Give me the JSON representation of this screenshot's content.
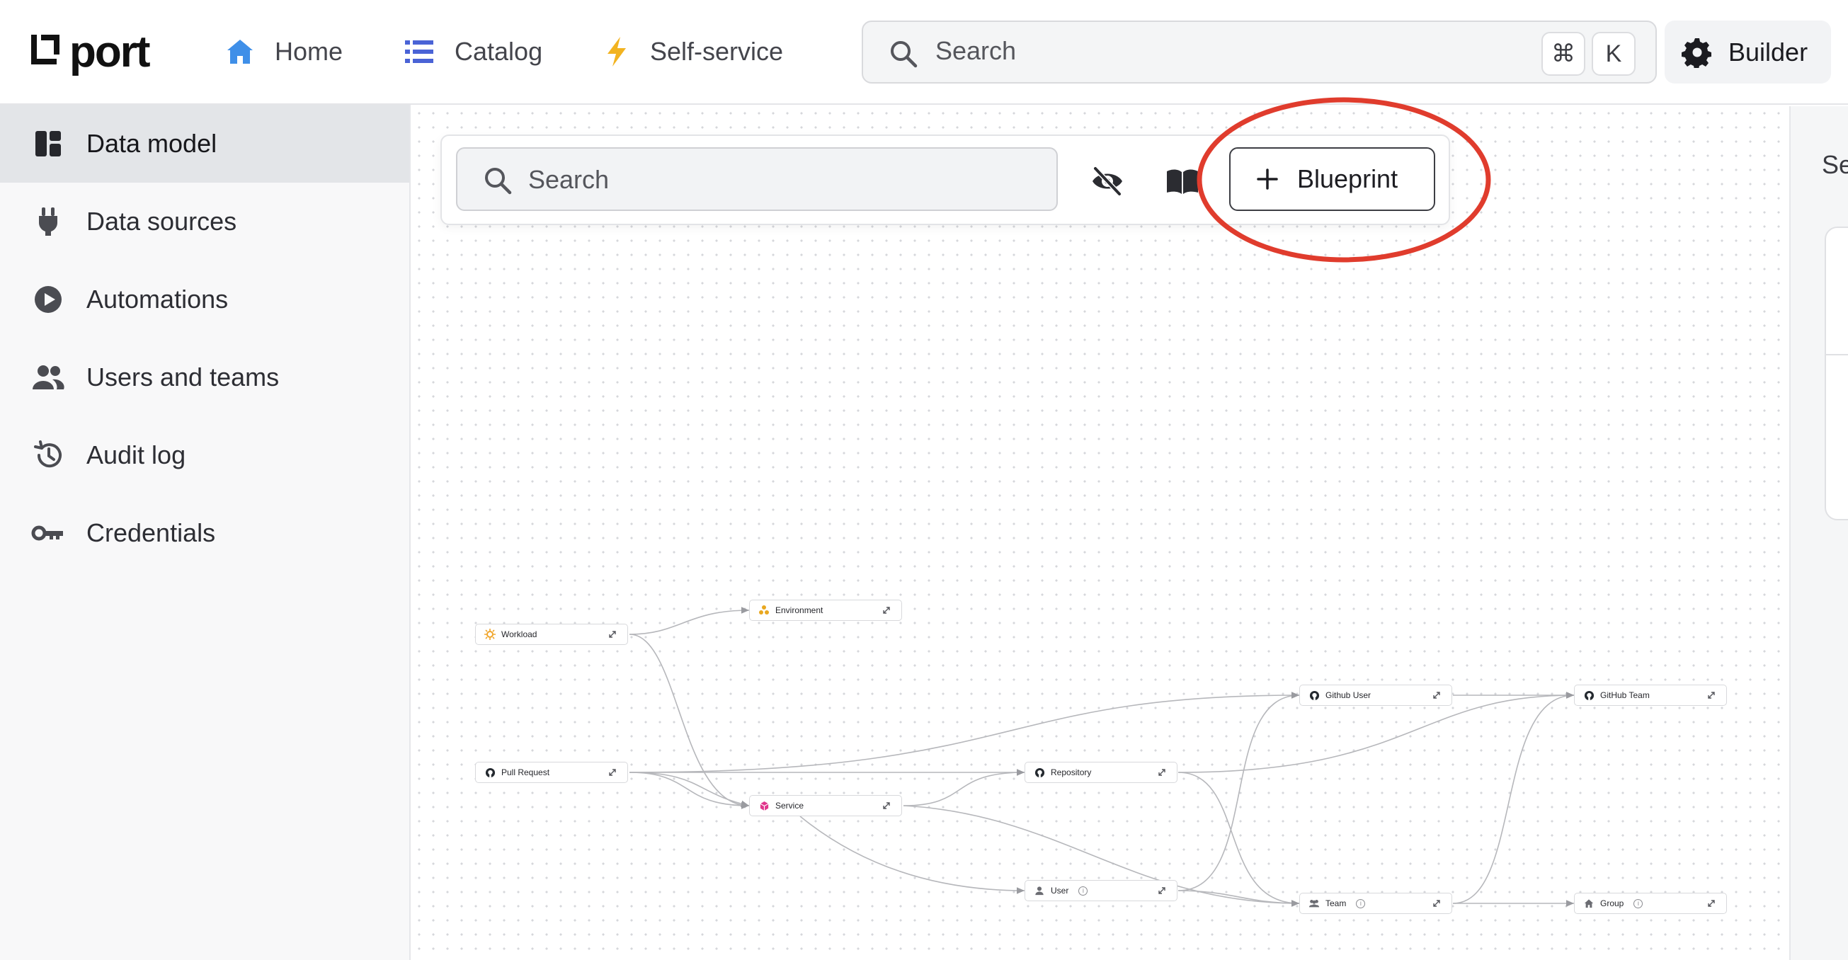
{
  "brand": {
    "name": "port"
  },
  "nav": {
    "home": "Home",
    "catalog": "Catalog",
    "self_service": "Self-service"
  },
  "global_search": {
    "placeholder": "Search",
    "kbd_cmd": "⌘",
    "kbd_key": "K"
  },
  "builder_label": "Builder",
  "sidebar": {
    "items": [
      {
        "label": "Data model",
        "icon": "dashboard-icon",
        "active": true
      },
      {
        "label": "Data sources",
        "icon": "plug-icon"
      },
      {
        "label": "Automations",
        "icon": "play-circle-icon"
      },
      {
        "label": "Users and teams",
        "icon": "people-icon"
      },
      {
        "label": "Audit log",
        "icon": "history-icon"
      },
      {
        "label": "Credentials",
        "icon": "key-icon"
      }
    ]
  },
  "canvas": {
    "search_placeholder": "Search",
    "add_blueprint_label": "Blueprint",
    "highlight_color": "#e03c2d"
  },
  "right_panel": {
    "peek_text": "Se"
  },
  "graph": {
    "nodes": {
      "workload": "Workload",
      "environment": "Environment",
      "github_user": "Github User",
      "github_team": "GitHub Team",
      "pull_request": "Pull Request",
      "repository": "Repository",
      "service": "Service",
      "user": "User",
      "team": "Team",
      "group": "Group"
    },
    "info_glyph": "i"
  },
  "colors": {
    "home_icon": "#3f8fe8",
    "catalog_icon": "#4a63d6",
    "self_service_icon": "#f2b320",
    "service_icon": "#e0368c",
    "environment_icon": "#e9a820",
    "workload_icon": "#f0a52a"
  }
}
